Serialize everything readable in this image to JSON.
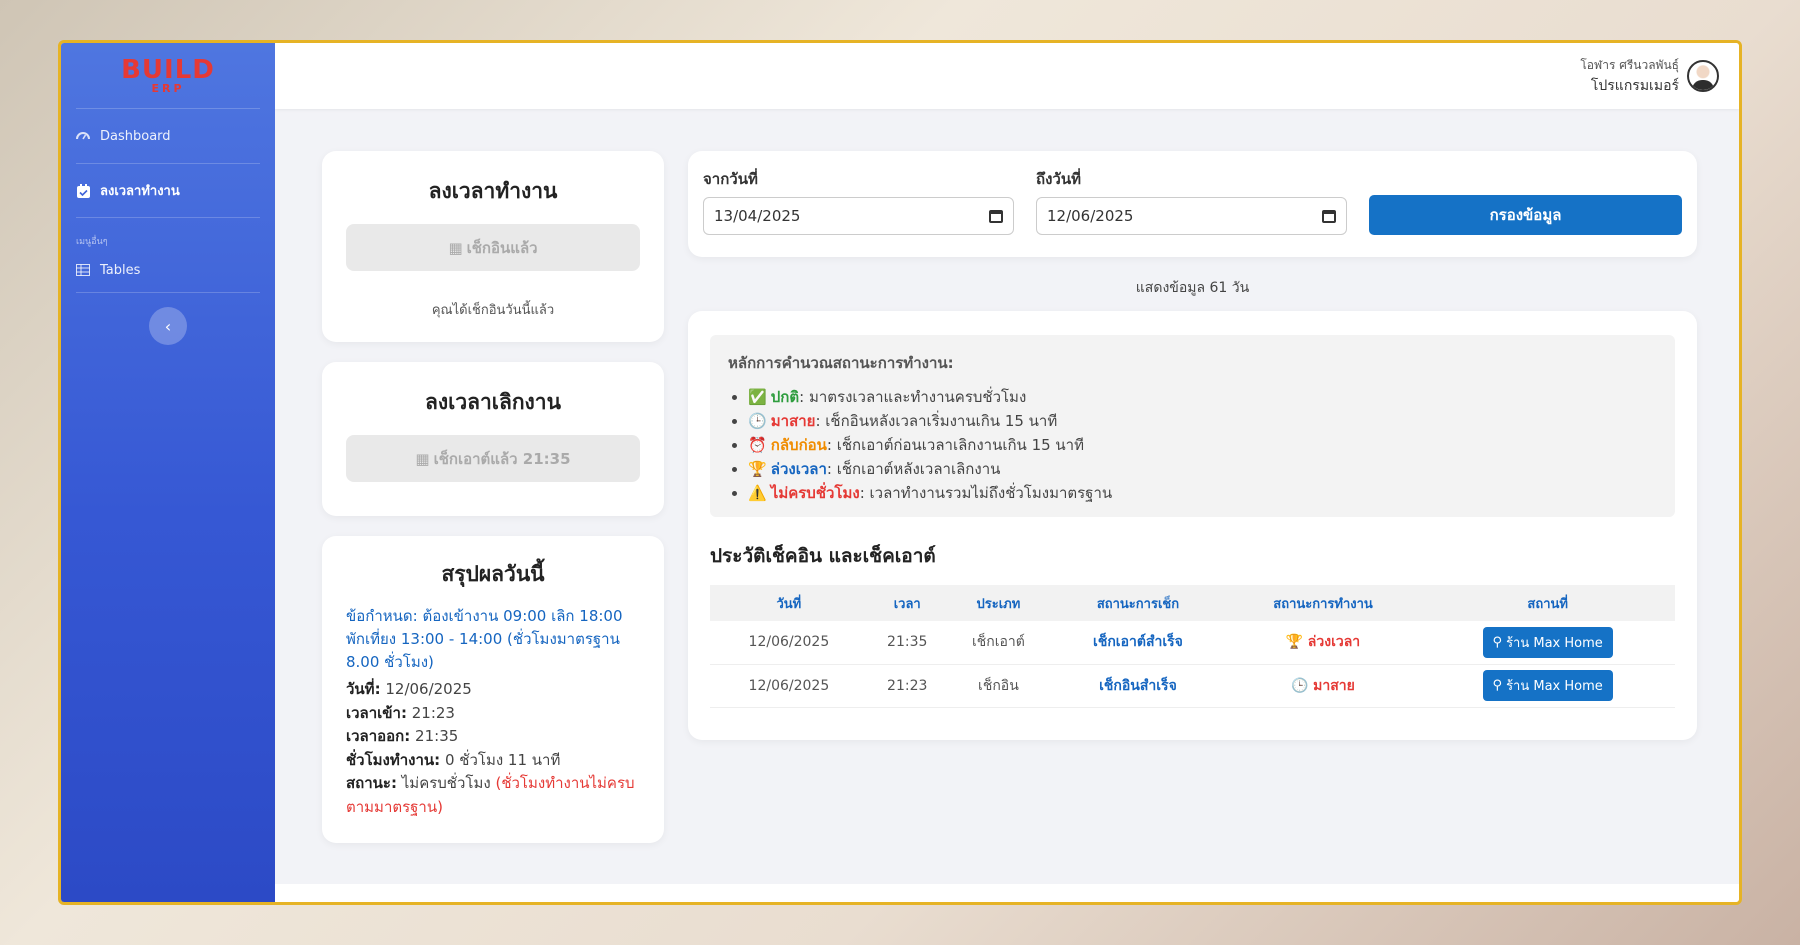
{
  "brand": {
    "logo_main": "BUILD",
    "logo_sub": "ERP"
  },
  "sidebar": {
    "items": [
      {
        "label": "Dashboard",
        "icon": "gauge-icon"
      },
      {
        "label": "ลงเวลาทำงาน",
        "icon": "calendar-check-icon"
      }
    ],
    "section_heading": "เมนูอื่นๆ",
    "other_items": [
      {
        "label": "Tables",
        "icon": "table-icon"
      }
    ]
  },
  "user": {
    "name": "โอฬาร ศรีนวลพันธุ์",
    "role": "โปรแกรมเมอร์"
  },
  "checkin": {
    "title": "ลงเวลาทำงาน",
    "button": "เช็กอินแล้ว",
    "note": "คุณได้เช็กอินวันนี้แล้ว"
  },
  "checkout": {
    "title": "ลงเวลาเลิกงาน",
    "button": "เช็กเอาต์แล้ว 21:35"
  },
  "summary": {
    "title": "สรุปผลวันนี้",
    "rule": "ข้อกำหนด: ต้องเข้างาน 09:00 เลิก 18:00 พักเที่ยง 13:00 - 14:00 (ชั่วโมงมาตรฐาน 8.00 ชั่วโมง)",
    "date_label": "วันที่:",
    "date": "12/06/2025",
    "in_label": "เวลาเข้า:",
    "in": "21:23",
    "out_label": "เวลาออก:",
    "out": "21:35",
    "hours_label": "ชั่วโมงทำงาน:",
    "hours": "0 ชั่วโมง 11 นาที",
    "status_label": "สถานะ:",
    "status": "ไม่ครบชั่วโมง",
    "status_note": "(ชั่วโมงทำงานไม่ครบตามมาตรฐาน)"
  },
  "filter": {
    "from_label": "จากวันที่",
    "from": "13/04/2025",
    "to_label": "ถึงวันที่",
    "to": "12/06/2025",
    "button": "กรองข้อมูล"
  },
  "days_info": "แสดงข้อมูล 61 วัน",
  "rules": {
    "title": "หลักการคำนวณสถานะการทำงาน:",
    "items": [
      {
        "emoji": "✅",
        "name": "ปกติ",
        "desc": ": มาตรงเวลาและทำงานครบชั่วโมง",
        "color": "#2e9d3e"
      },
      {
        "emoji": "🕒",
        "name": "มาสาย",
        "desc": ": เช็กอินหลังเวลาเริ่มงานเกิน 15 นาที",
        "color": "#e53935"
      },
      {
        "emoji": "⏰",
        "name": "กลับก่อน",
        "desc": ": เช็กเอาต์ก่อนเวลาเลิกงานเกิน 15 นาที",
        "color": "#f08c00"
      },
      {
        "emoji": "🏆",
        "name": "ล่วงเวลา",
        "desc": ": เช็กเอาต์หลังเวลาเลิกงาน",
        "color": "#1565c0"
      },
      {
        "emoji": "⚠️",
        "name": "ไม่ครบชั่วโมง",
        "desc": ": เวลาทำงานรวมไม่ถึงชั่วโมงมาตรฐาน",
        "color": "#e53935"
      }
    ]
  },
  "history": {
    "title": "ประวัติเช็คอิน และเช็คเอาต์",
    "columns": [
      "วันที่",
      "เวลา",
      "ประเภท",
      "สถานะการเช็ก",
      "สถานะการทำงาน",
      "สถานที่"
    ],
    "rows": [
      {
        "date": "12/06/2025",
        "time": "21:35",
        "type": "เช็กเอาต์",
        "check_status": "เช็กเอาต์สำเร็จ",
        "work_emoji": "🏆",
        "work_status": "ล่วงเวลา",
        "work_color": "#e53935",
        "location": "ร้าน Max Home"
      },
      {
        "date": "12/06/2025",
        "time": "21:23",
        "type": "เช็กอิน",
        "check_status": "เช็กอินสำเร็จ",
        "work_emoji": "🕒",
        "work_status": "มาสาย",
        "work_color": "#e53935",
        "location": "ร้าน Max Home"
      }
    ]
  }
}
